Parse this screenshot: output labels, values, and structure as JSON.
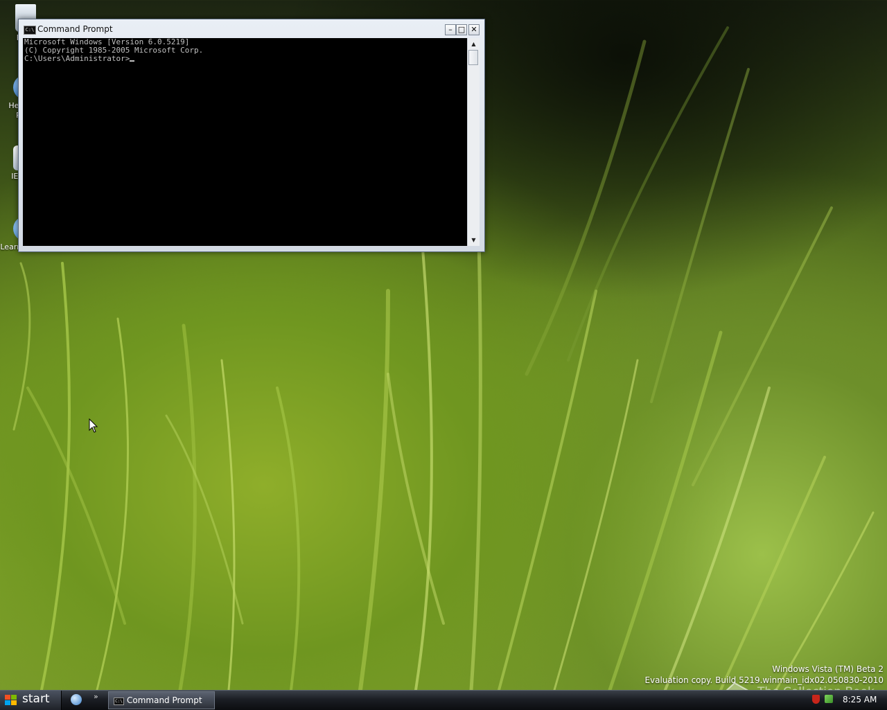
{
  "desktop": {
    "icons": [
      {
        "label": "Recy",
        "icon": "recycle-bin-icon"
      },
      {
        "label": "Help and Repo",
        "icon": "help-icon"
      },
      {
        "label": "IE Supp",
        "icon": "support-icon"
      },
      {
        "label": "Learn more...",
        "icon": "internet-explorer-icon"
      }
    ]
  },
  "window": {
    "title": "Command Prompt",
    "icon": "cmd-icon",
    "console_lines": [
      "Microsoft Windows [Version 6.0.5219]",
      "(C) Copyright 1985-2005 Microsoft Corp.",
      "",
      "C:\\Users\\Administrator>"
    ],
    "controls": {
      "minimize": "minimize-icon",
      "maximize": "maximize-icon",
      "close": "close-icon"
    }
  },
  "watermark": {
    "line1": "Windows Vista (TM) Beta 2",
    "line2": "Evaluation copy. Build 5219.winmain_idx02.050830-2010",
    "site": "The Collection Book"
  },
  "taskbar": {
    "start_label": "start",
    "tasks": [
      {
        "label": "Command Prompt",
        "icon": "cmd-icon"
      }
    ],
    "clock": "8:25 AM"
  },
  "colors": {
    "console_bg": "#000000",
    "console_fg": "#c0c0c0",
    "taskbar_bg": "#1b1e24"
  }
}
